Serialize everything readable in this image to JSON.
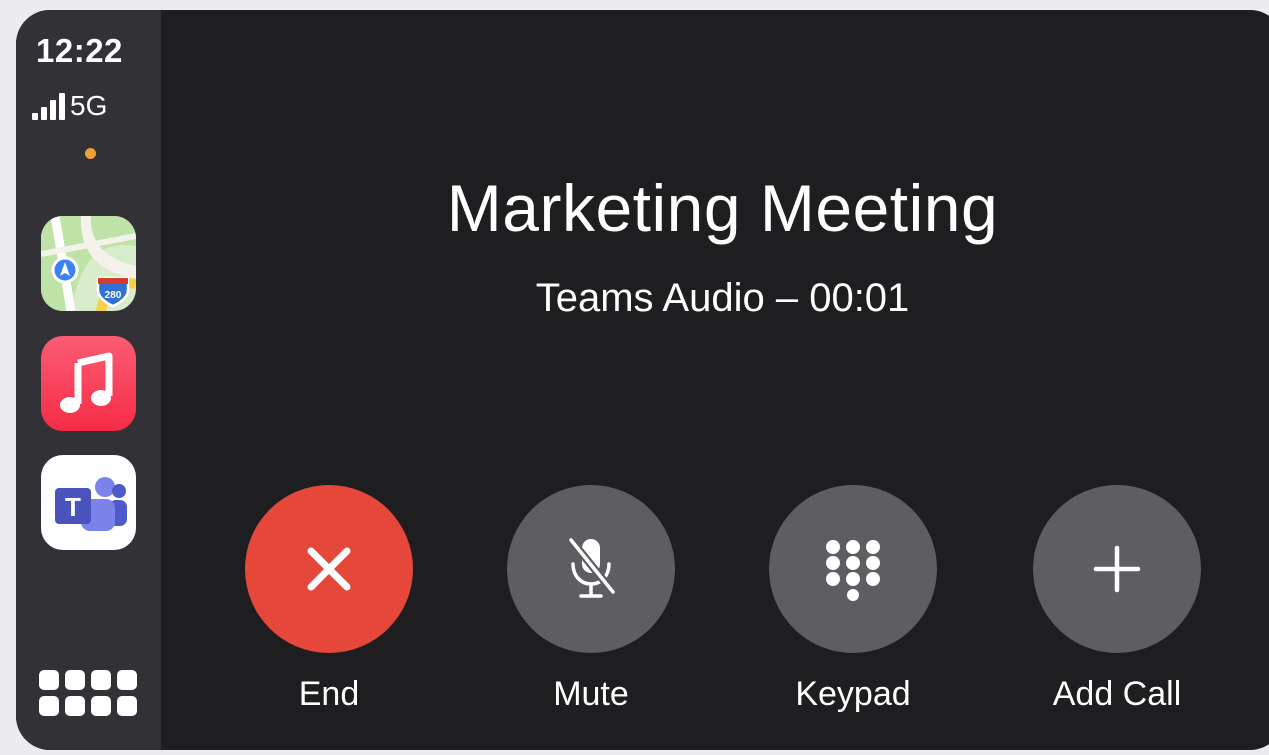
{
  "status": {
    "time": "12:22",
    "network": "5G",
    "signal_icon": "cellular-signal-icon",
    "indicator_color": "#f0a03a"
  },
  "sidebar": {
    "apps": [
      {
        "name": "Maps",
        "icon": "maps-icon",
        "shield_number": "280"
      },
      {
        "name": "Music",
        "icon": "music-icon"
      },
      {
        "name": "Teams",
        "icon": "teams-icon",
        "letter": "T"
      }
    ],
    "home_icon": "app-grid-icon"
  },
  "call": {
    "title": "Marketing Meeting",
    "subtitle": "Teams Audio – 00:01"
  },
  "controls": [
    {
      "label": "End",
      "icon": "close-icon",
      "color": "#e5473a"
    },
    {
      "label": "Mute",
      "icon": "microphone-slash-icon",
      "color": "#5e5e62"
    },
    {
      "label": "Keypad",
      "icon": "keypad-icon",
      "color": "#5e5e62"
    },
    {
      "label": "Add Call",
      "icon": "plus-icon",
      "color": "#5e5e62"
    }
  ]
}
